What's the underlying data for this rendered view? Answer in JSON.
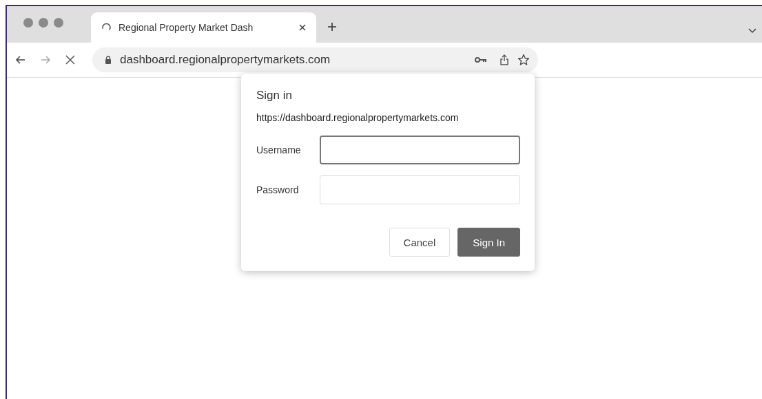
{
  "tabs": [
    {
      "title": "Regional Property Market Dash",
      "loading": true,
      "selected": true
    }
  ],
  "address_bar": {
    "url": "dashboard.regionalpropertymarkets.com"
  },
  "dialog": {
    "title": "Sign in",
    "origin": "https://dashboard.regionalpropertymarkets.com",
    "fields": [
      {
        "label": "Username",
        "focused": true
      },
      {
        "label": "Password",
        "focused": false
      }
    ],
    "buttons": [
      {
        "label": "Cancel",
        "kind": "secondary"
      },
      {
        "label": "Sign In",
        "kind": "primary"
      }
    ]
  }
}
